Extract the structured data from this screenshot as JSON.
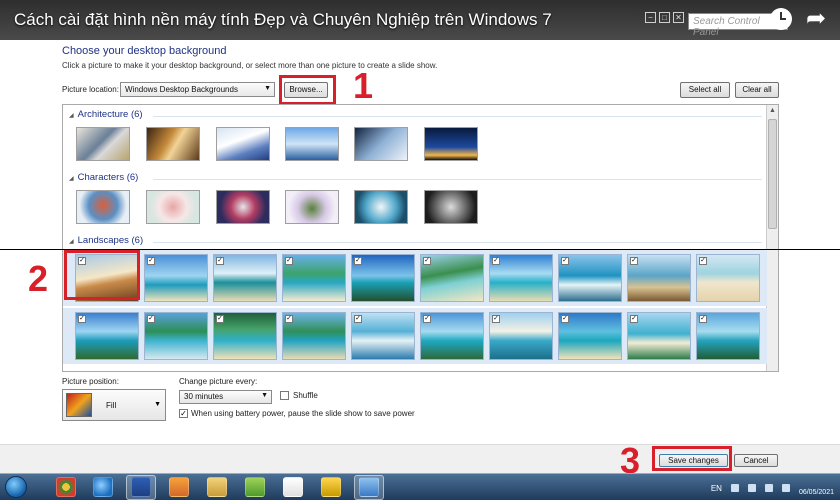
{
  "video_title": "Cách cài đặt hình nền máy tính Đẹp và Chuyên Nghiệp trên Windows 7",
  "window": {
    "search_placeholder": "Search Control Panel",
    "controls": [
      "−",
      "□",
      "✕"
    ]
  },
  "header": {
    "heading": "Choose your desktop background",
    "subtext": "Click a picture to make it your desktop background, or select more than one picture to create a slide show."
  },
  "location": {
    "label": "Picture location:",
    "value": "Windows Desktop Backgrounds",
    "browse_label": "Browse...",
    "select_all_label": "Select all",
    "clear_all_label": "Clear all"
  },
  "gallery": {
    "groups": [
      {
        "label": "Architecture (6)",
        "count": 6
      },
      {
        "label": "Characters (6)",
        "count": 6
      },
      {
        "label": "Landscapes (6)",
        "count": 6
      }
    ]
  },
  "steps": {
    "one": "1",
    "two": "2",
    "three": "3"
  },
  "position": {
    "label": "Picture position:",
    "value": "Fill"
  },
  "change": {
    "label": "Change picture every:",
    "value": "30 minutes",
    "shuffle_label": "Shuffle",
    "shuffle_checked": false,
    "battery_label": "When using battery power, pause the slide show to save power",
    "battery_checked": true
  },
  "footer": {
    "save_label": "Save changes",
    "cancel_label": "Cancel"
  },
  "taskbar": {
    "language": "EN",
    "date": "06/05/2021"
  },
  "colors": {
    "highlight_red": "#d8202a",
    "heading_blue": "#1e3287",
    "selection_blue": "#dde9f7"
  }
}
